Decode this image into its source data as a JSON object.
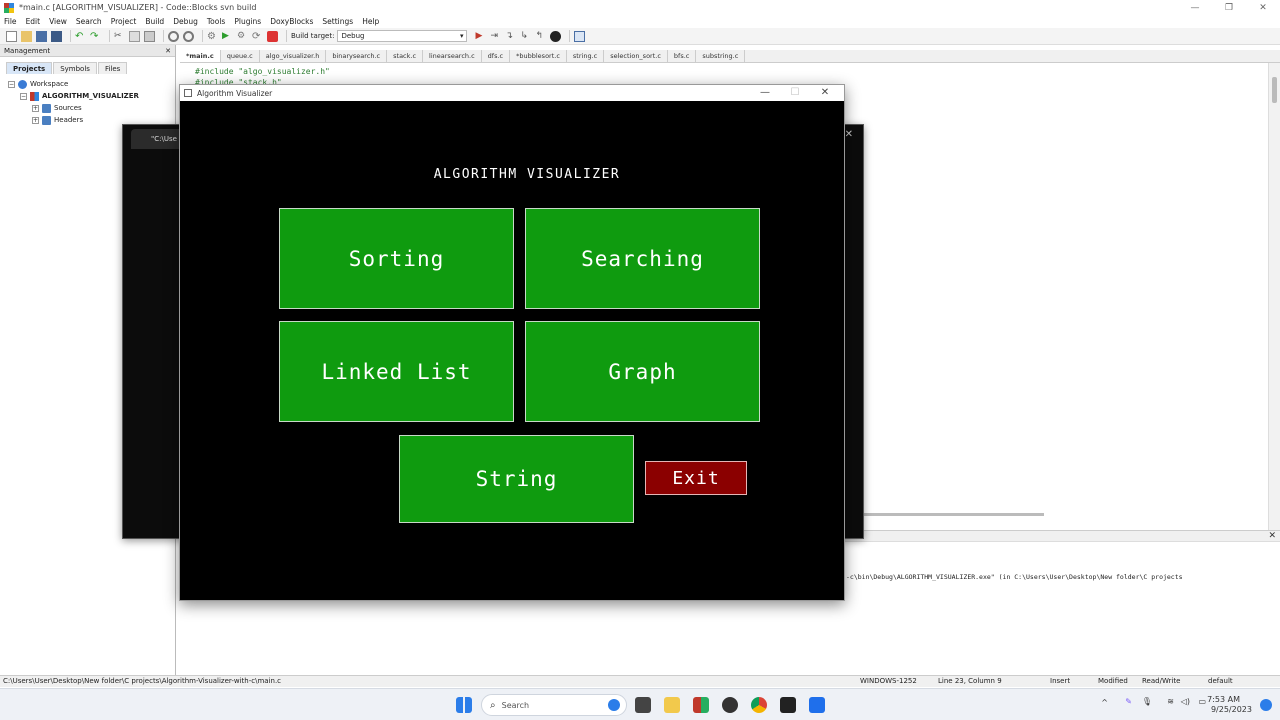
{
  "ide": {
    "title": "*main.c [ALGORITHM_VISUALIZER] - Code::Blocks svn build",
    "window_controls": [
      "—",
      "❐",
      "✕"
    ]
  },
  "menu": [
    "File",
    "Edit",
    "View",
    "Search",
    "Project",
    "Build",
    "Debug",
    "Tools",
    "Plugins",
    "DoxyBlocks",
    "Settings",
    "Help"
  ],
  "toolbar": {
    "build_target_label": "Build target:",
    "build_target_value": "Debug"
  },
  "management": {
    "title": "Management",
    "tabs": [
      "Projects",
      "Symbols",
      "Files"
    ],
    "tree": {
      "workspace": "Workspace",
      "project": "ALGORITHM_VISUALIZER",
      "sources": "Sources",
      "headers": "Headers"
    }
  },
  "editor": {
    "tabs": [
      "*main.c",
      "queue.c",
      "algo_visualizer.h",
      "binarysearch.c",
      "stack.c",
      "linearsearch.c",
      "dfs.c",
      "*bubblesort.c",
      "string.c",
      "selection_sort.c",
      "bfs.c",
      "substring.c"
    ],
    "code_line_1": "#include \"algo_visualizer.h\"",
    "code_line_2": "#include \"stack.h\""
  },
  "console": {
    "tab_label": "\"C:\\Use"
  },
  "visualizer": {
    "window_title": "Algorithm Visualizer",
    "heading": "ALGORITHM VISUALIZER",
    "buttons": {
      "sorting": "Sorting",
      "searching": "Searching",
      "linked_list": "Linked List",
      "graph": "Graph",
      "string": "String",
      "exit": "Exit"
    },
    "colors": {
      "button": "#0f9b0f",
      "exit": "#8b0000",
      "background": "#000000"
    }
  },
  "logs": {
    "line": "-c\\bin\\Debug\\ALGORITHM_VISUALIZER.exe\"  (in C:\\Users\\User\\Desktop\\New folder\\C projects"
  },
  "statusbar": {
    "path": "C:\\Users\\User\\Desktop\\New folder\\C projects\\Algorithm-Visualizer-with-c\\main.c",
    "encoding": "WINDOWS-1252",
    "position": "Line 23, Column 9",
    "mode": "Insert",
    "modified": "Modified",
    "access": "Read/Write",
    "profile": "default"
  },
  "taskbar": {
    "search_placeholder": "Search",
    "time": "7:53 AM",
    "date": "9/25/2023"
  }
}
